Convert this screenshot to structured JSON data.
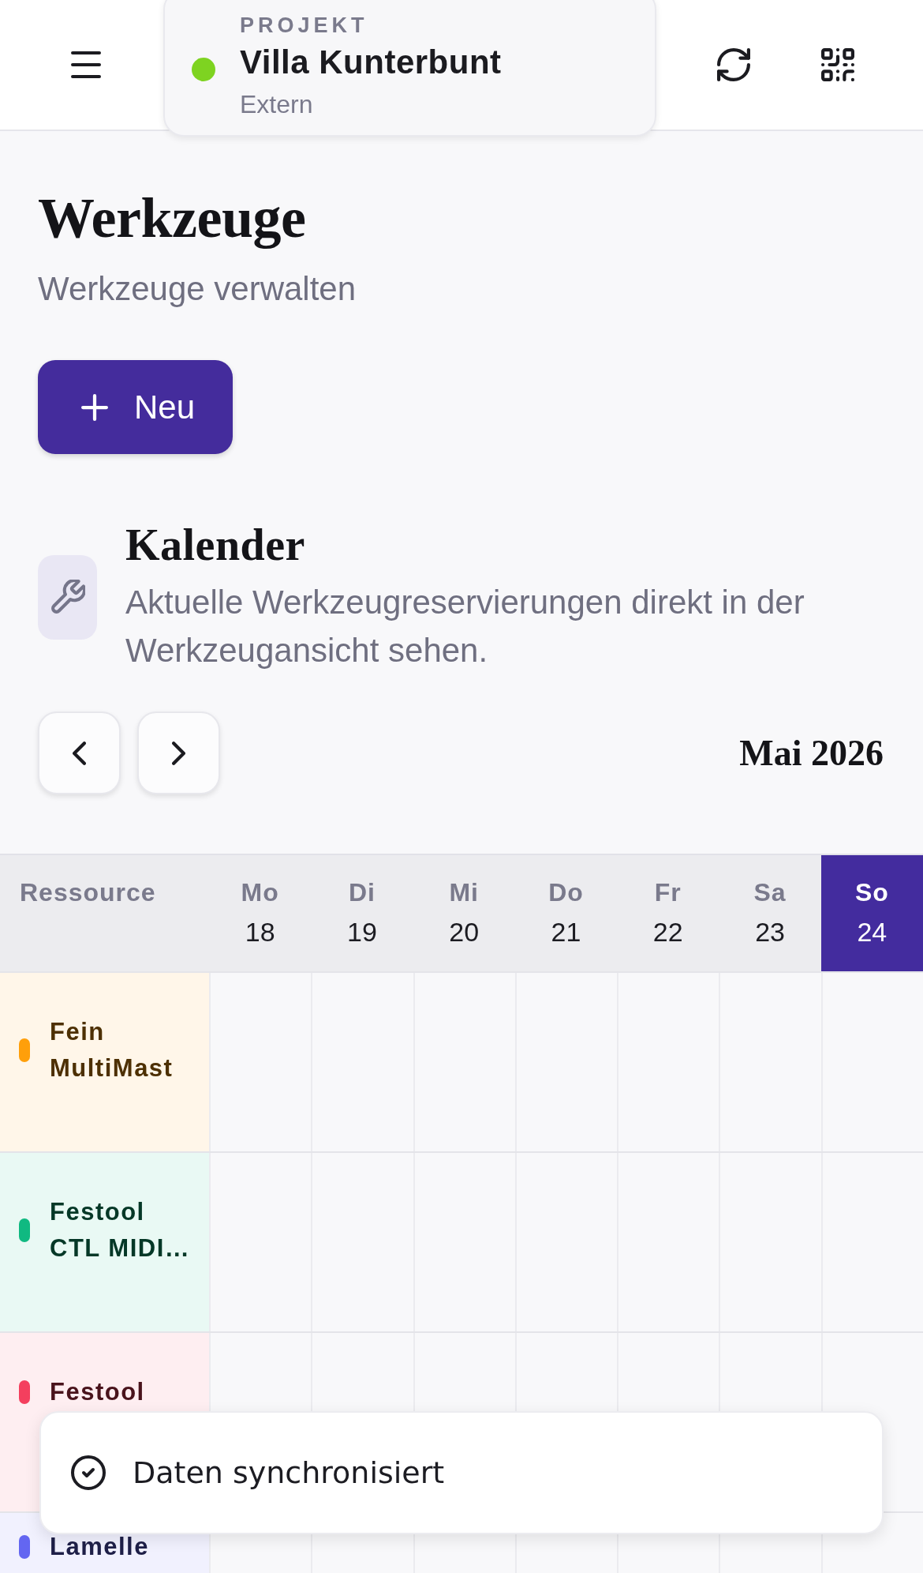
{
  "header": {
    "project": {
      "label": "PROJEKT",
      "name": "Villa Kunterbunt",
      "role": "Extern",
      "color": "#7ed321"
    }
  },
  "page": {
    "title": "Werkzeuge",
    "subtitle": "Werkzeuge verwalten",
    "new_button": "Neu"
  },
  "calendar": {
    "title": "Kalender",
    "description": "Aktuelle Werkzeugreservierungen direkt in der Werkzeugansicht sehen.",
    "month": "Mai 2026",
    "resource_header": "Ressource",
    "days": [
      {
        "weekday": "Mo",
        "date": "18",
        "selected": false
      },
      {
        "weekday": "Di",
        "date": "19",
        "selected": false
      },
      {
        "weekday": "Mi",
        "date": "20",
        "selected": false
      },
      {
        "weekday": "Do",
        "date": "21",
        "selected": false
      },
      {
        "weekday": "Fr",
        "date": "22",
        "selected": false
      },
      {
        "weekday": "Sa",
        "date": "23",
        "selected": false
      },
      {
        "weekday": "So",
        "date": "24",
        "selected": true
      }
    ],
    "resources": [
      {
        "name": "Fein MultiMast",
        "color": "#ff9f0a"
      },
      {
        "name": "Festool CTL MIDI…",
        "color": "#10b981"
      },
      {
        "name": "Festool",
        "color": "#f43f5e"
      },
      {
        "name": "Lamelle",
        "color": "#6366f1"
      }
    ]
  },
  "toast": {
    "message": "Daten synchronisiert"
  }
}
